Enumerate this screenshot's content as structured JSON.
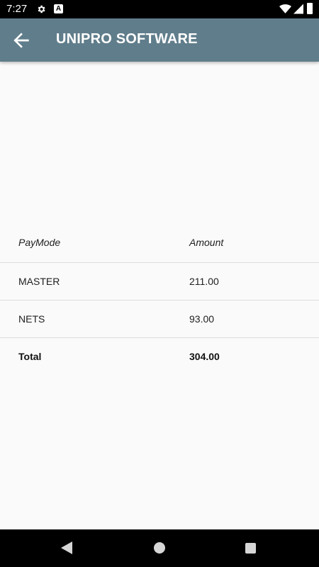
{
  "status_bar": {
    "time": "7:27",
    "icons": [
      "gear-icon",
      "a-badge-icon",
      "wifi-icon",
      "signal-icon",
      "battery-icon"
    ]
  },
  "app_bar": {
    "title": "UNIPRO SOFTWARE",
    "back_icon": "arrow-left-icon",
    "color": "#607d8b"
  },
  "table": {
    "headers": [
      "PayMode",
      "Amount"
    ],
    "rows": [
      [
        "MASTER",
        "211.00"
      ],
      [
        "NETS",
        "93.00"
      ]
    ],
    "total": {
      "label": "Total",
      "amount": "304.00"
    }
  },
  "nav_bar": {
    "icons": [
      "back-triangle-icon",
      "home-circle-icon",
      "recents-square-icon"
    ]
  }
}
